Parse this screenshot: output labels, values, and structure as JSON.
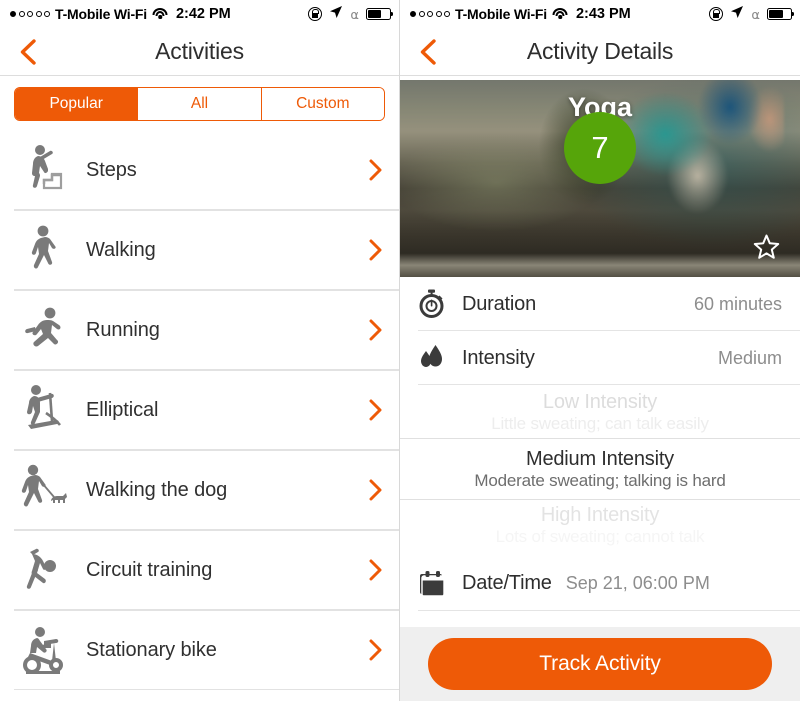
{
  "accent_color": "#EE5A07",
  "badge_color": "#56A50A",
  "left_screen": {
    "status_bar": {
      "signal_dots_filled": 1,
      "signal_dots_total": 5,
      "carrier": "T-Mobile Wi-Fi",
      "wifi_icon": "wifi-icon",
      "time": "2:42 PM",
      "rotation_lock_icon": "rotation-lock-icon",
      "location_icon": "location-arrow-icon",
      "bluetooth_icon": "bluetooth-icon",
      "battery_icon": "battery-icon",
      "battery_level": 62
    },
    "nav": {
      "back_icon": "back-chevron-icon",
      "title": "Activities"
    },
    "segmented": {
      "options": [
        {
          "label": "Popular",
          "selected": true
        },
        {
          "label": "All",
          "selected": false
        },
        {
          "label": "Custom",
          "selected": false
        }
      ]
    },
    "activities": [
      {
        "label": "Steps",
        "icon": "steps-icon",
        "chevron": "chevron-right-icon"
      },
      {
        "label": "Walking",
        "icon": "walking-icon",
        "chevron": "chevron-right-icon"
      },
      {
        "label": "Running",
        "icon": "running-icon",
        "chevron": "chevron-right-icon"
      },
      {
        "label": "Elliptical",
        "icon": "elliptical-icon",
        "chevron": "chevron-right-icon"
      },
      {
        "label": "Walking the dog",
        "icon": "walking-dog-icon",
        "chevron": "chevron-right-icon"
      },
      {
        "label": "Circuit training",
        "icon": "circuit-training-icon",
        "chevron": "chevron-right-icon"
      },
      {
        "label": "Stationary bike",
        "icon": "stationary-bike-icon",
        "chevron": "chevron-right-icon"
      }
    ]
  },
  "right_screen": {
    "status_bar": {
      "signal_dots_filled": 1,
      "signal_dots_total": 5,
      "carrier": "T-Mobile Wi-Fi",
      "wifi_icon": "wifi-icon",
      "time": "2:43 PM",
      "rotation_lock_icon": "rotation-lock-icon",
      "location_icon": "location-arrow-icon",
      "bluetooth_icon": "bluetooth-icon",
      "battery_icon": "battery-icon",
      "battery_level": 66
    },
    "nav": {
      "back_icon": "back-chevron-icon",
      "title": "Activity Details"
    },
    "hero": {
      "activity_name": "Yoga",
      "badge_value": "7",
      "favorite_icon": "star-outline-icon"
    },
    "details": [
      {
        "icon": "stopwatch-icon",
        "label": "Duration",
        "value": "60 minutes"
      },
      {
        "icon": "water-drops-icon",
        "label": "Intensity",
        "value": "Medium"
      }
    ],
    "intensity_picker": [
      {
        "title": "Low Intensity",
        "subtitle": "Little sweating; can talk easily",
        "selected": false
      },
      {
        "title": "Medium Intensity",
        "subtitle": "Moderate sweating; talking is hard",
        "selected": true
      },
      {
        "title": "High Intensity",
        "subtitle": "Lots of sweating; cannot talk",
        "selected": false
      }
    ],
    "datetime": {
      "icon": "calendar-icon",
      "label": "Date/Time",
      "value": "Sep 21, 06:00 PM"
    },
    "footer": {
      "track_label": "Track Activity"
    }
  }
}
